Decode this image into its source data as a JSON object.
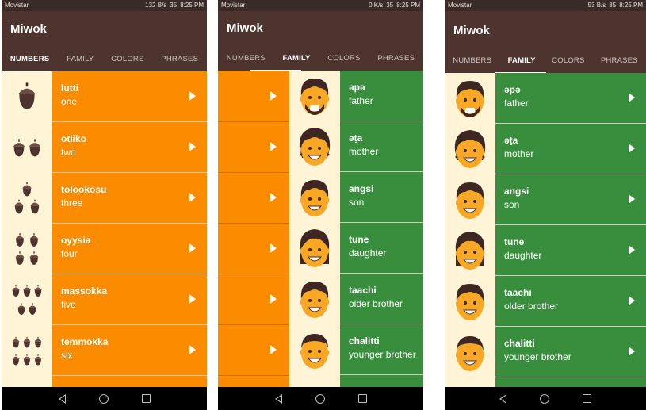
{
  "status_left": [
    "Movistar",
    "Movistar",
    "Movistar"
  ],
  "status_right": [
    {
      "speed": "132 B/s",
      "battery": "35",
      "time": "8:25 PM"
    },
    {
      "speed": "0 K/s",
      "battery": "35",
      "time": "8:25 PM"
    },
    {
      "speed": "53 B/s",
      "battery": "35",
      "time": "8:25 PM"
    }
  ],
  "app_title": "Miwok",
  "tabs": [
    "NUMBERS",
    "FAMILY",
    "COLORS",
    "PHRASES"
  ],
  "numbers": [
    {
      "miwok": "lutti",
      "english": "one",
      "count": 1
    },
    {
      "miwok": "otiiko",
      "english": "two",
      "count": 2
    },
    {
      "miwok": "tolookosu",
      "english": "three",
      "count": 3
    },
    {
      "miwok": "oyysia",
      "english": "four",
      "count": 4
    },
    {
      "miwok": "massokka",
      "english": "five",
      "count": 5
    },
    {
      "miwok": "temmokka",
      "english": "six",
      "count": 6
    }
  ],
  "family": [
    {
      "miwok": "әpә",
      "english": "father"
    },
    {
      "miwok": "әṭa",
      "english": "mother"
    },
    {
      "miwok": "angsi",
      "english": "son"
    },
    {
      "miwok": "tune",
      "english": "daughter"
    },
    {
      "miwok": "taachi",
      "english": "older brother"
    },
    {
      "miwok": "chalitti",
      "english": "younger brother"
    }
  ],
  "colors": {
    "numbers": "#fb8c00",
    "family": "#388e3c",
    "thumb_bg": "#fff4d6",
    "appbar": "#4e342e",
    "statusbar": "#3b2b27"
  },
  "icons": {
    "row_action": "play-icon",
    "acorn": "acorn-icon",
    "face": "face-icon"
  }
}
